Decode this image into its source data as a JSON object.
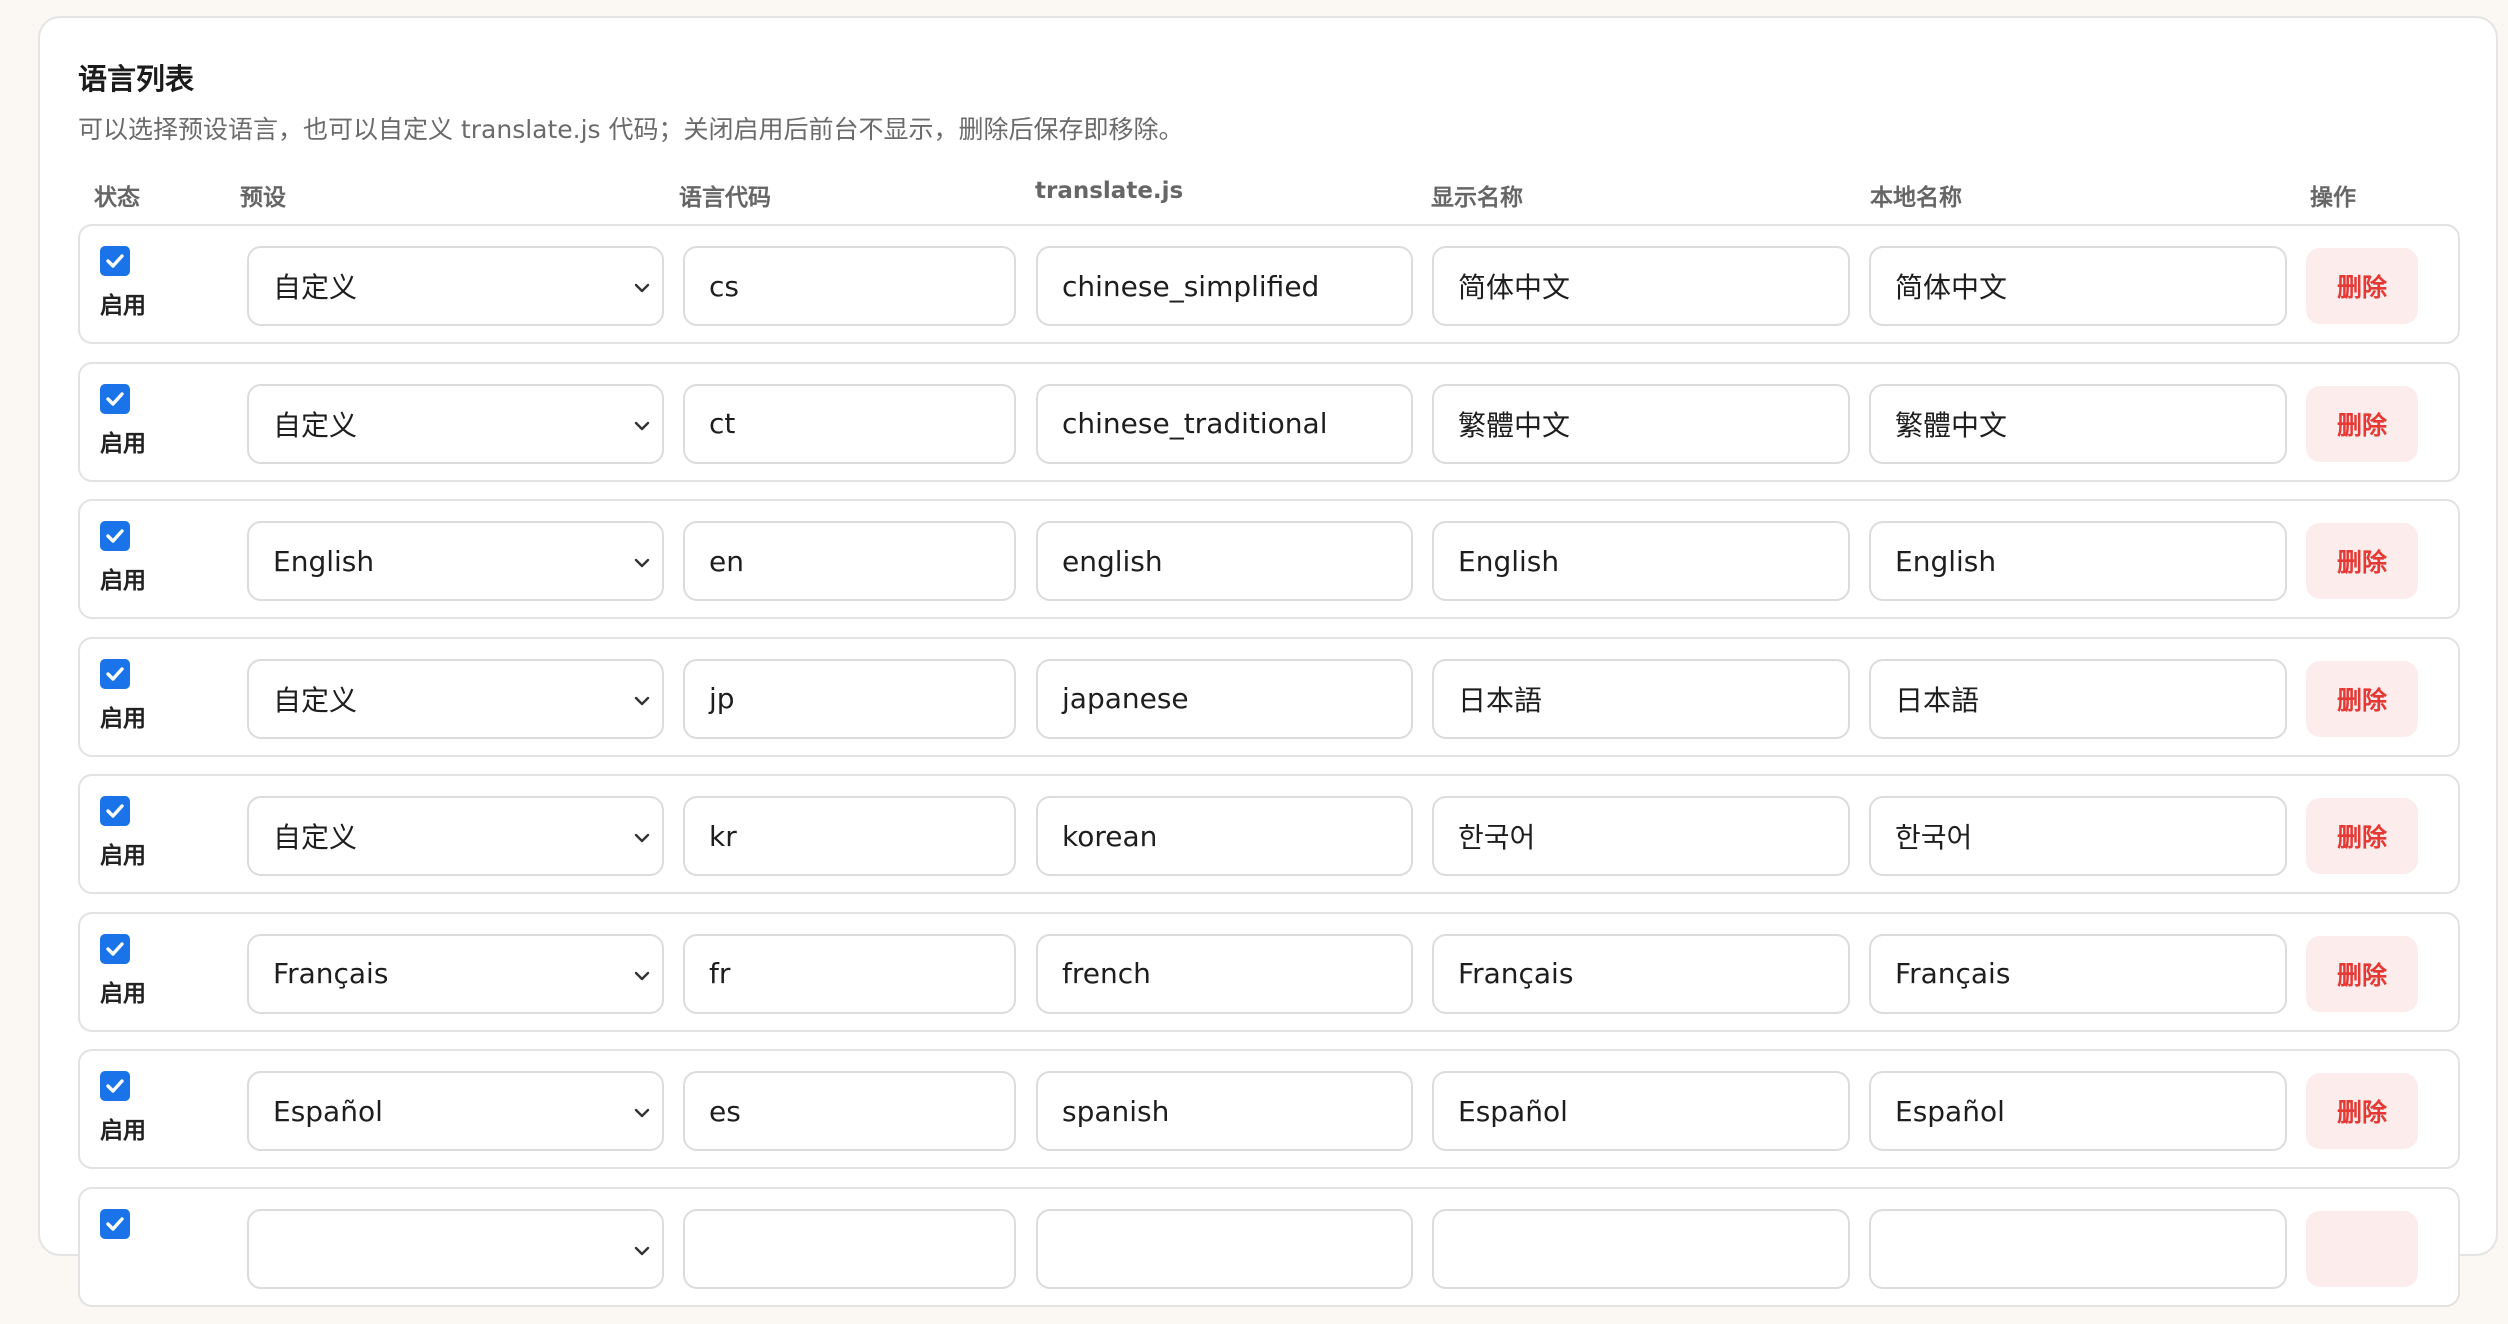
{
  "section": {
    "title": "语言列表",
    "description": "可以选择预设语言，也可以自定义 translate.js 代码；关闭启用后前台不显示，删除后保存即移除。"
  },
  "columns": {
    "status": "状态",
    "preset": "预设",
    "code": "语言代码",
    "tjs": "translate.js",
    "display": "显示名称",
    "local": "本地名称",
    "action": "操作"
  },
  "rows": [
    {
      "enabled": true,
      "enabled_label": "启用",
      "preset": "自定义",
      "code": "cs",
      "tjs": "chinese_simplified",
      "display": "简体中文",
      "local": "简体中文",
      "delete_label": "删除"
    },
    {
      "enabled": true,
      "enabled_label": "启用",
      "preset": "自定义",
      "code": "ct",
      "tjs": "chinese_traditional",
      "display": "繁體中文",
      "local": "繁體中文",
      "delete_label": "删除"
    },
    {
      "enabled": true,
      "enabled_label": "启用",
      "preset": "English",
      "code": "en",
      "tjs": "english",
      "display": "English",
      "local": "English",
      "delete_label": "删除"
    },
    {
      "enabled": true,
      "enabled_label": "启用",
      "preset": "自定义",
      "code": "jp",
      "tjs": "japanese",
      "display": "日本語",
      "local": "日本語",
      "delete_label": "删除"
    },
    {
      "enabled": true,
      "enabled_label": "启用",
      "preset": "自定义",
      "code": "kr",
      "tjs": "korean",
      "display": "한국어",
      "local": "한국어",
      "delete_label": "删除"
    },
    {
      "enabled": true,
      "enabled_label": "启用",
      "preset": "Français",
      "code": "fr",
      "tjs": "french",
      "display": "Français",
      "local": "Français",
      "delete_label": "删除"
    },
    {
      "enabled": true,
      "enabled_label": "启用",
      "preset": "Español",
      "code": "es",
      "tjs": "spanish",
      "display": "Español",
      "local": "Español",
      "delete_label": "删除"
    },
    {
      "enabled": true,
      "enabled_label": "",
      "preset": "",
      "code": "",
      "tjs": "",
      "display": "",
      "local": "",
      "delete_label": ""
    }
  ],
  "colors": {
    "checkbox": "#1a73e8",
    "delete_text": "#e53935",
    "delete_bg": "#fdecec"
  }
}
